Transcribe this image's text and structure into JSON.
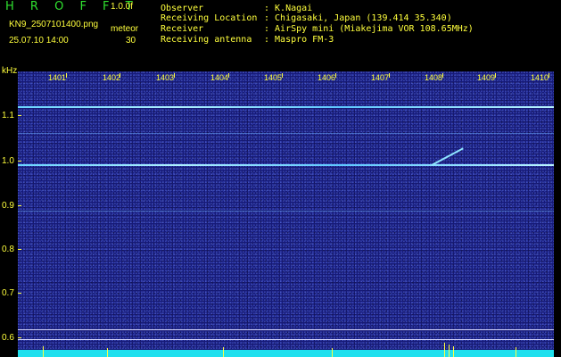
{
  "header": {
    "brand": "H R O F F T",
    "version": "1.0.0f",
    "filename": "KN9_2507101400.png",
    "datetime": "25.07.10 14:00",
    "mode_label": "meteor",
    "mode_value": "30"
  },
  "info": [
    {
      "label": "Observer",
      "value": ": K.Nagai"
    },
    {
      "label": "Receiving Location",
      "value": ": Chigasaki, Japan (139.414 35.340)"
    },
    {
      "label": "Receiver",
      "value": ": AirSpy mini (Miakejima VOR 108.65MHz)"
    },
    {
      "label": "Receiving antenna",
      "value": ": Maspro FM-3"
    }
  ],
  "axis": {
    "unit": "kHz",
    "x_ticks": [
      "1401",
      "1402",
      "1403",
      "1404",
      "1405",
      "1406",
      "1407",
      "1408",
      "1409",
      "1410"
    ],
    "y_ticks": [
      "1.1",
      "1.0",
      "0.9",
      "0.8",
      "0.7",
      "0.6"
    ]
  },
  "colors": {
    "text": "#ffff3c",
    "brand": "#2fe02f",
    "background": "#161a78",
    "signal": "#8fe6ff"
  }
}
